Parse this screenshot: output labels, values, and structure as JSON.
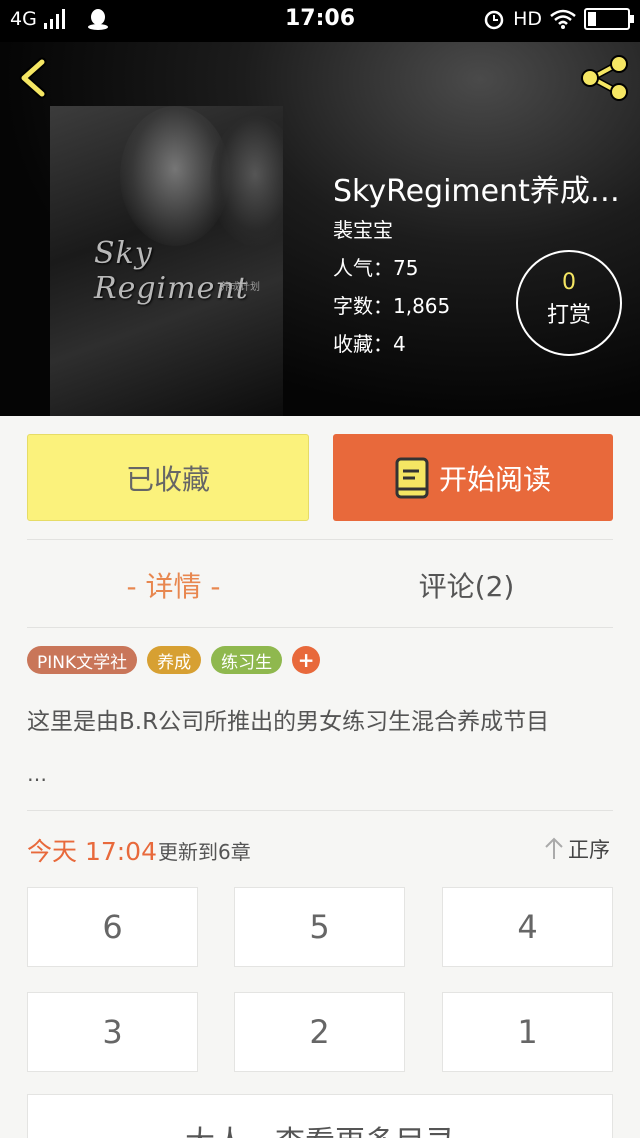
{
  "status_bar": {
    "network": "4G",
    "time": "17:06",
    "hd": "HD"
  },
  "book": {
    "title": "SkyRegiment养成计划",
    "author": "裴宝宝",
    "popularity": "人气：75",
    "word_count": "字数：1,865",
    "favorites": "收藏：4",
    "cover_text": "Sky Regiment",
    "cover_sub": "养成计划"
  },
  "reward": {
    "count": "0",
    "label": "打赏"
  },
  "actions": {
    "favorited_label": "已收藏",
    "read_label": "开始阅读"
  },
  "tabs": {
    "details": "- 详情 -",
    "comments": "评论(2)"
  },
  "tags": [
    {
      "label": "PINK文学社",
      "color": "#c97659"
    },
    {
      "label": "养成",
      "color": "#d7a032"
    },
    {
      "label": "练习生",
      "color": "#8fb84e"
    }
  ],
  "intro": "这里是由B.R公司所推出的男女练习生混合养成节目",
  "intro_more": "…",
  "update": {
    "date": "今天 17:04",
    "text": "更新到6章",
    "sort_label": "正序"
  },
  "chapters": [
    "6",
    "5",
    "4",
    "3",
    "2",
    "1"
  ],
  "more_label": "大人，查看更多目录",
  "colors": {
    "accent": "#e8693b",
    "favorite_bg": "#fbf27c",
    "back_icon": "#f5e663"
  }
}
